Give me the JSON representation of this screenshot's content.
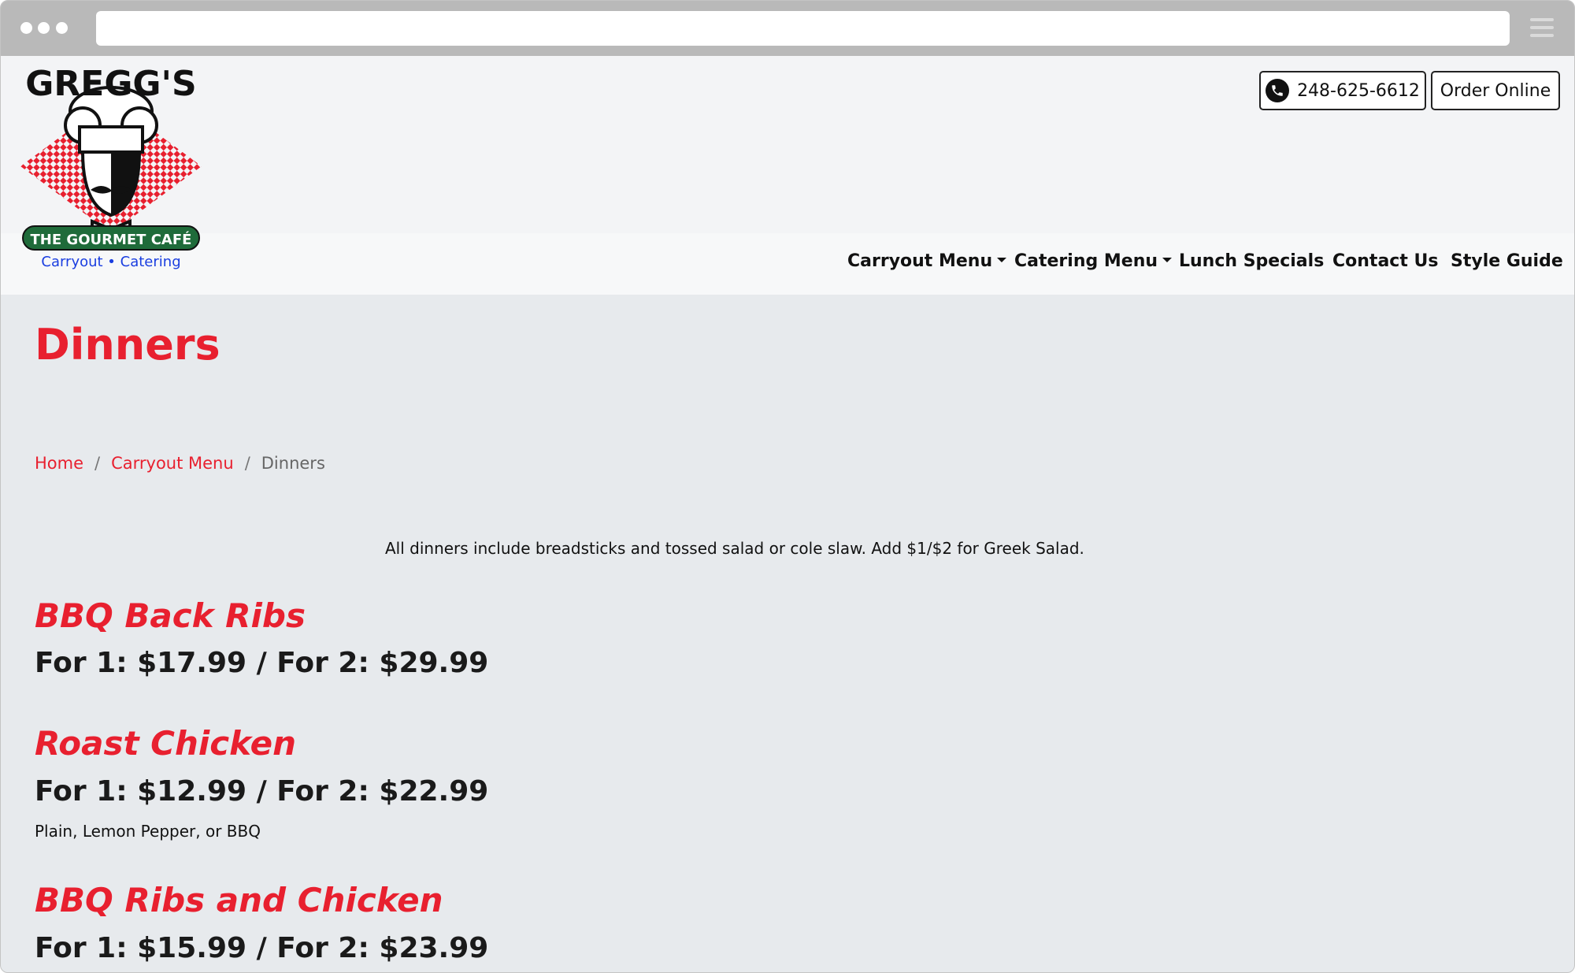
{
  "header": {
    "logo_text": "GREGG'S",
    "logo_banner": "THE GOURMET CAFÉ",
    "logo_tagline": "Carryout • Catering",
    "phone": "248-625-6612",
    "order_label": "Order Online"
  },
  "nav": {
    "items": [
      {
        "label": "Carryout Menu",
        "dropdown": true
      },
      {
        "label": "Catering Menu",
        "dropdown": true
      },
      {
        "label": "Lunch Specials",
        "dropdown": false
      },
      {
        "label": "Contact Us",
        "dropdown": false
      },
      {
        "label": "Style Guide",
        "dropdown": false
      }
    ]
  },
  "page": {
    "title": "Dinners",
    "breadcrumb": {
      "home": "Home",
      "parent": "Carryout Menu",
      "current": "Dinners",
      "separator": "/"
    },
    "intro": "All dinners include breadsticks and tossed salad or cole slaw. Add $1/$2 for Greek Salad."
  },
  "menu_items": [
    {
      "name": "BBQ Back Ribs",
      "price": "For 1: $17.99 / For 2: $29.99",
      "description": ""
    },
    {
      "name": "Roast Chicken",
      "price": "For 1: $12.99 / For 2: $22.99",
      "description": "Plain, Lemon Pepper, or BBQ"
    },
    {
      "name": "BBQ Ribs and Chicken",
      "price": "For 1: $15.99 / For 2: $23.99",
      "description": ""
    }
  ],
  "colors": {
    "accent": "#e8202f",
    "logo_green": "#1f6b3a",
    "logo_blue": "#1a3ee0"
  }
}
